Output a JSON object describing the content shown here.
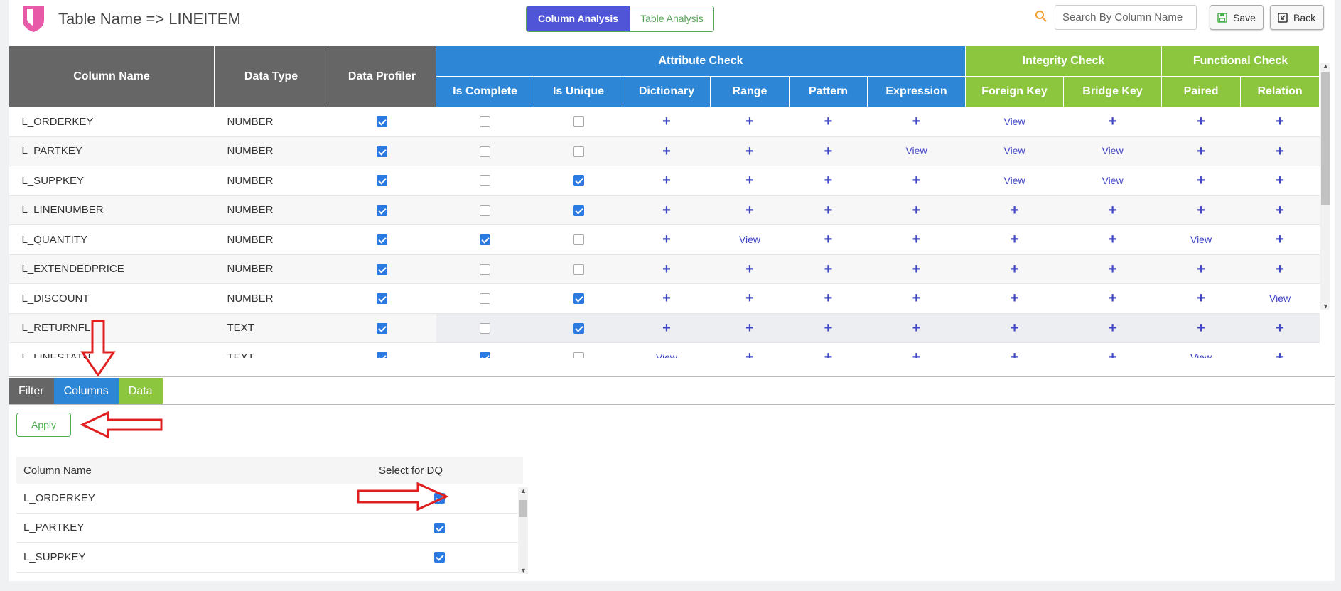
{
  "header": {
    "title": "Table Name => LINEITEM",
    "tab_column_analysis": "Column Analysis",
    "tab_table_analysis": "Table Analysis",
    "search_placeholder": "Search By Column Name",
    "save_label": "Save",
    "back_label": "Back"
  },
  "grid": {
    "col_name": "Column Name",
    "col_type": "Data Type",
    "col_profiler": "Data Profiler",
    "group_attribute": "Attribute Check",
    "group_integrity": "Integrity Check",
    "group_functional": "Functional Check",
    "sub_headers": [
      "Is Complete",
      "Is Unique",
      "Dictionary",
      "Range",
      "Pattern",
      "Expression",
      "Foreign Key",
      "Bridge Key",
      "Paired",
      "Relation"
    ],
    "rows": [
      {
        "name": "L_ORDERKEY",
        "type": "NUMBER",
        "profiler": true,
        "complete": false,
        "unique": false,
        "checks": [
          "+",
          "+",
          "+",
          "+",
          "View",
          "+",
          "+",
          "+"
        ]
      },
      {
        "name": "L_PARTKEY",
        "type": "NUMBER",
        "profiler": true,
        "complete": false,
        "unique": false,
        "checks": [
          "+",
          "+",
          "+",
          "View",
          "View",
          "View",
          "+",
          "+"
        ]
      },
      {
        "name": "L_SUPPKEY",
        "type": "NUMBER",
        "profiler": true,
        "complete": false,
        "unique": true,
        "checks": [
          "+",
          "+",
          "+",
          "+",
          "View",
          "View",
          "+",
          "+"
        ]
      },
      {
        "name": "L_LINENUMBER",
        "type": "NUMBER",
        "profiler": true,
        "complete": false,
        "unique": true,
        "checks": [
          "+",
          "+",
          "+",
          "+",
          "+",
          "+",
          "+",
          "+"
        ]
      },
      {
        "name": "L_QUANTITY",
        "type": "NUMBER",
        "profiler": true,
        "complete": true,
        "unique": false,
        "checks": [
          "+",
          "View",
          "+",
          "+",
          "+",
          "+",
          "View",
          "+"
        ]
      },
      {
        "name": "L_EXTENDEDPRICE",
        "type": "NUMBER",
        "profiler": true,
        "complete": false,
        "unique": false,
        "checks": [
          "+",
          "+",
          "+",
          "+",
          "+",
          "+",
          "+",
          "+"
        ]
      },
      {
        "name": "L_DISCOUNT",
        "type": "NUMBER",
        "profiler": true,
        "complete": false,
        "unique": true,
        "checks": [
          "+",
          "+",
          "+",
          "+",
          "+",
          "+",
          "+",
          "View"
        ]
      },
      {
        "name": "L_RETURNFL",
        "type": "TEXT",
        "profiler": true,
        "complete": false,
        "unique": true,
        "checks": [
          "+",
          "+",
          "+",
          "+",
          "+",
          "+",
          "+",
          "+"
        ]
      },
      {
        "name": "L_LINESTATU",
        "type": "TEXT",
        "profiler": true,
        "complete": true,
        "unique": false,
        "checks": [
          "View",
          "+",
          "+",
          "+",
          "+",
          "+",
          "View",
          "+"
        ]
      }
    ]
  },
  "tabs": {
    "filter": "Filter",
    "columns": "Columns",
    "data": "Data"
  },
  "apply_label": "Apply",
  "select_table": {
    "col_name": "Column Name",
    "col_select": "Select for DQ",
    "rows": [
      {
        "name": "L_ORDERKEY",
        "selected": true
      },
      {
        "name": "L_PARTKEY",
        "selected": true
      },
      {
        "name": "L_SUPPKEY",
        "selected": true
      }
    ]
  },
  "colors": {
    "accent_blue": "#2d87d6",
    "accent_green": "#8cc63f",
    "header_gray": "#666666",
    "link": "#4046c4",
    "annotation_red": "#e02020"
  }
}
